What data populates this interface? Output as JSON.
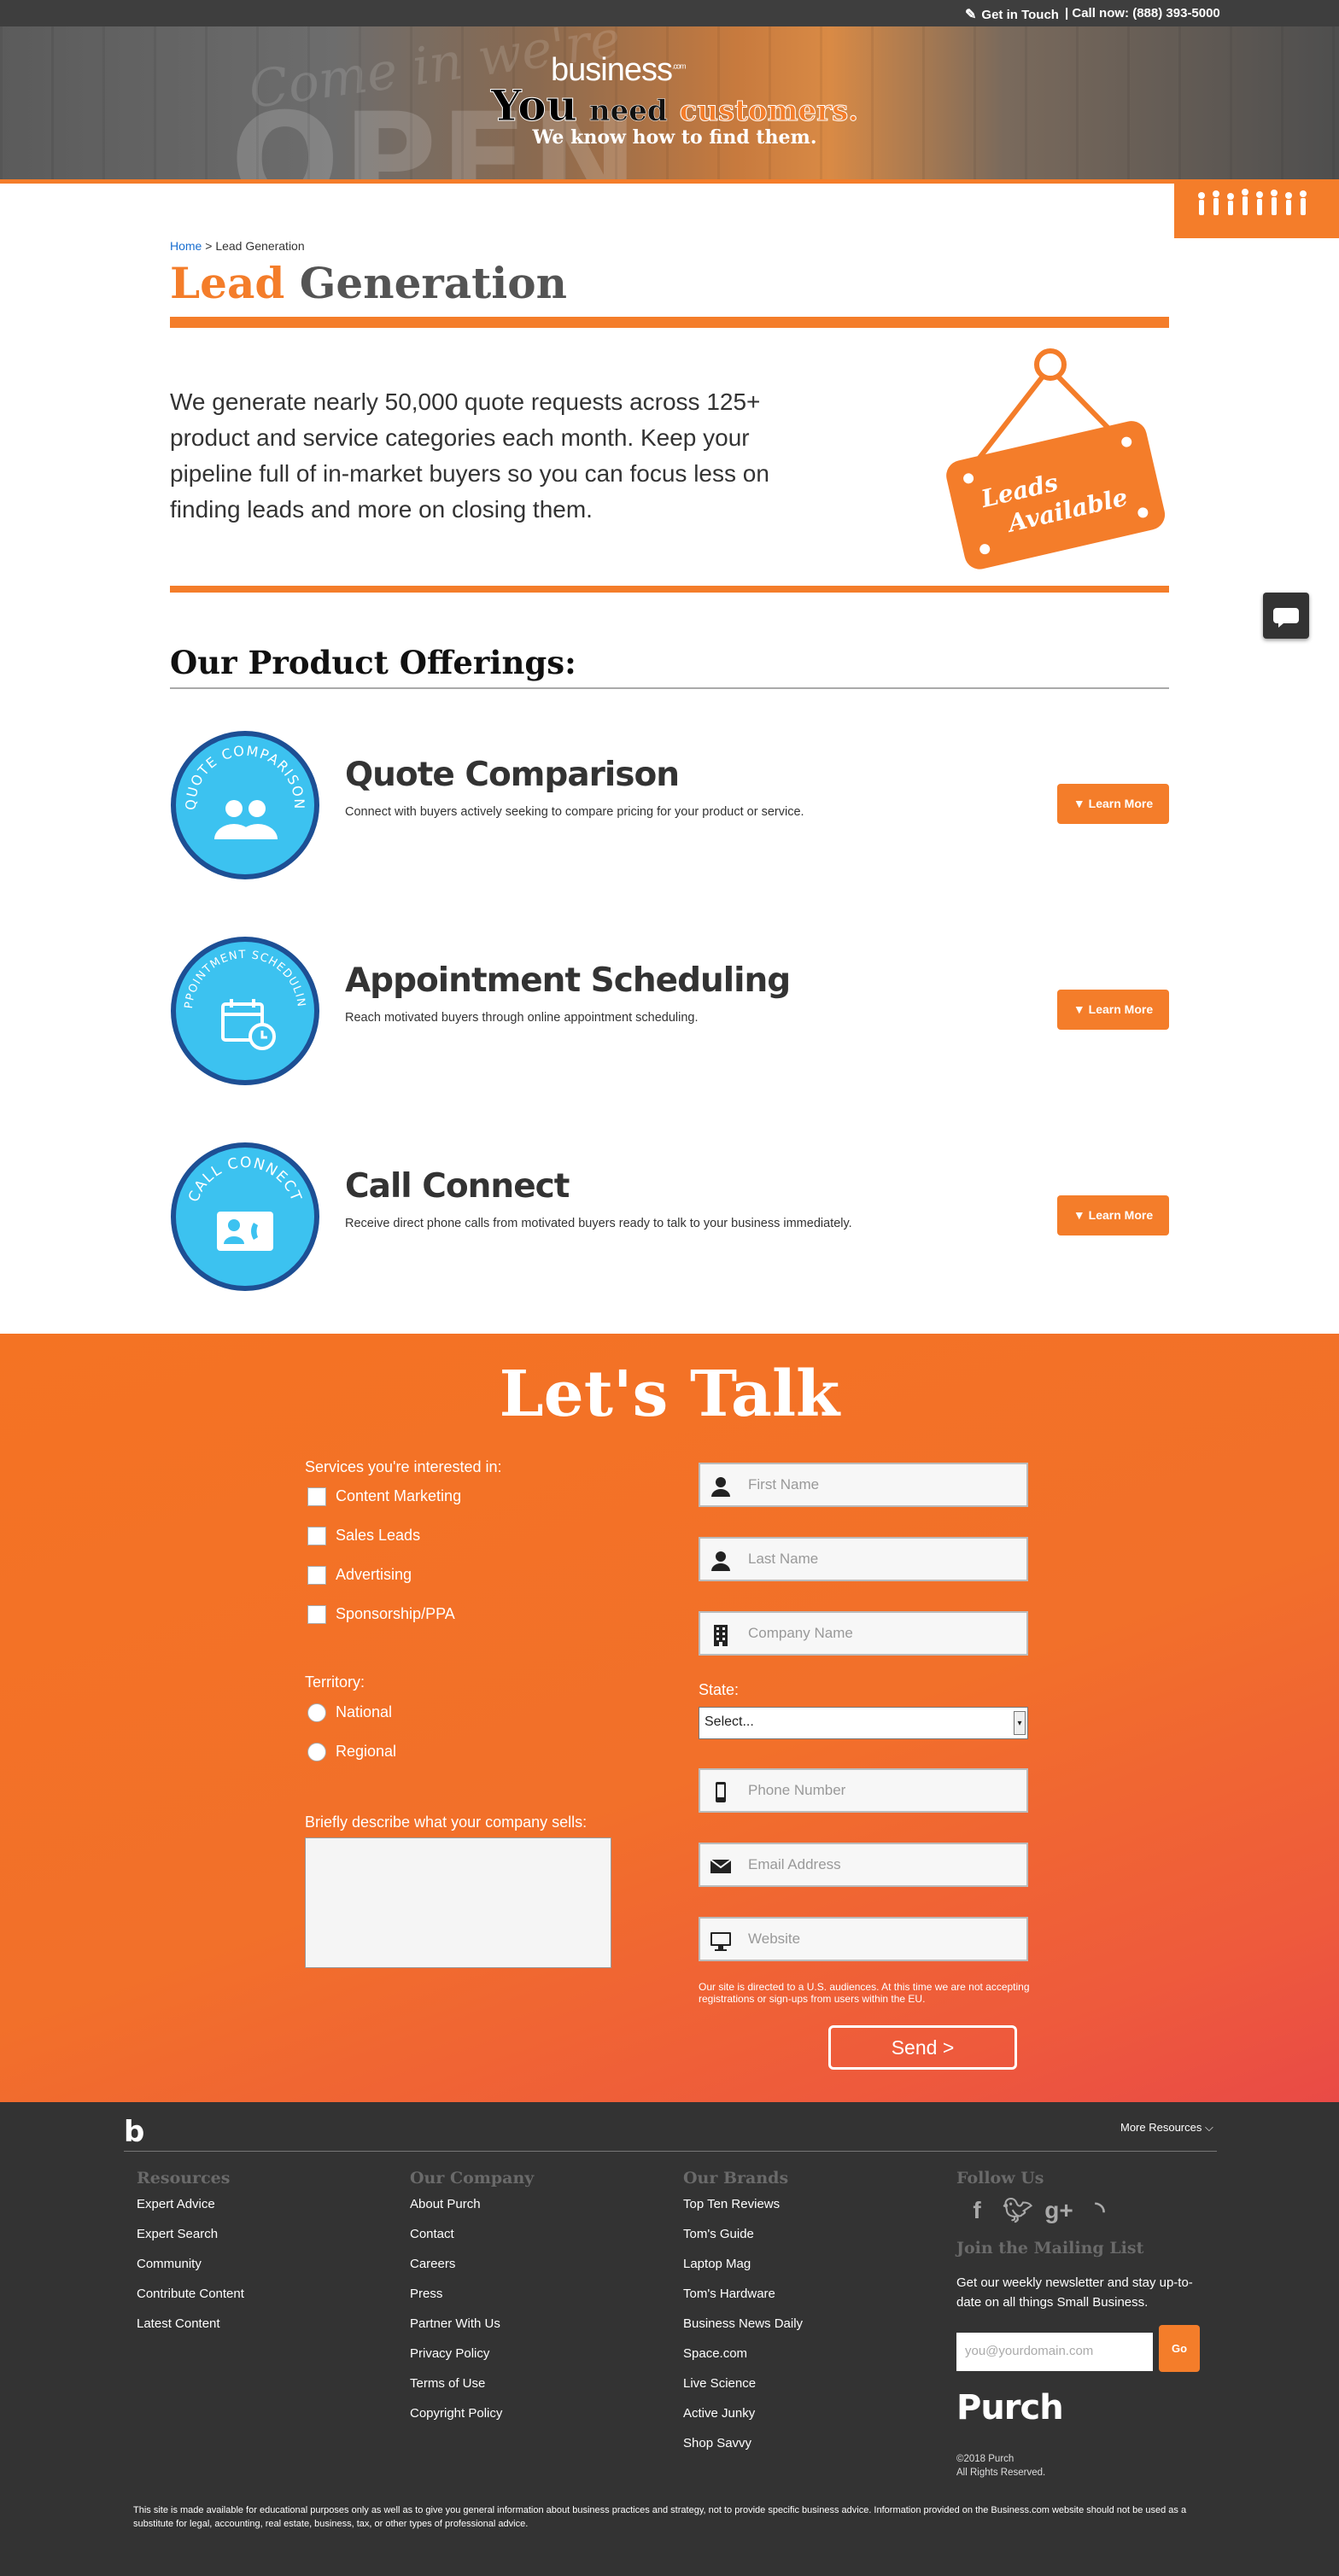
{
  "topbar": {
    "get_in_touch": "Get in Touch",
    "call_now": "| Call now: (888) 393-5000"
  },
  "hero": {
    "brand": "business",
    "brand_sup": ".com",
    "you": "You",
    "need": "need",
    "customers": "customers.",
    "subline": "We know how to find them."
  },
  "breadcrumb": {
    "home": "Home",
    "sep": " > ",
    "current": "Lead Generation"
  },
  "page_title": {
    "accent": "Lead",
    "rest": " Generation"
  },
  "intro": "We generate nearly 50,000 quote requests across 125+ product and service categories each month. Keep your pipeline full of in-market buyers so you can focus less on finding leads and more on closing them.",
  "sign": {
    "line1": "Leads",
    "line2": "Available"
  },
  "offerings": {
    "heading": "Our Product Offerings:",
    "items": [
      {
        "badge": "QUOTE COMPARISON",
        "title": "Quote Comparison",
        "desc": "Connect with buyers actively seeking to compare pricing for your product or service.",
        "button": "▼ Learn More"
      },
      {
        "badge": "APPOINTMENT SCHEDULING",
        "title": "Appointment Scheduling",
        "desc": "Reach motivated buyers through online appointment scheduling.",
        "button": "▼ Learn More"
      },
      {
        "badge": "CALL CONNECT",
        "title": "Call Connect",
        "desc": "Receive direct phone calls from motivated buyers ready to talk to your business immediately.",
        "button": "▼ Learn More"
      }
    ]
  },
  "talk": {
    "heading": "Let's Talk",
    "services_label": "Services you're interested in:",
    "services": [
      "Content Marketing",
      "Sales Leads",
      "Advertising",
      "Sponsorship/PPA"
    ],
    "territory_label": "Territory:",
    "territories": [
      "National",
      "Regional"
    ],
    "describe_label": "Briefly describe what your company sells:",
    "fields": {
      "first_name": "First Name",
      "last_name": "Last Name",
      "company": "Company Name",
      "phone": "Phone Number",
      "email": "Email Address",
      "website": "Website"
    },
    "state_label": "State:",
    "state_value": "Select...",
    "disclaimer": "Our site is directed to a U.S. audiences. At this time we are not accepting registrations or sign-ups from users within the EU.",
    "send": "Send >"
  },
  "footer": {
    "logo": "b",
    "more_resources": "More Resources ⌵",
    "resources": {
      "heading": "Resources",
      "links": [
        "Expert Advice",
        "Expert Search",
        "Community",
        "Contribute Content",
        "Latest Content"
      ]
    },
    "company": {
      "heading": "Our Company",
      "links": [
        "About Purch",
        "Contact",
        "Careers",
        "Press",
        "Partner With Us",
        "Privacy Policy",
        "Terms of Use",
        "Copyright Policy"
      ]
    },
    "brands": {
      "heading": "Our Brands",
      "links": [
        "Top Ten Reviews",
        "Tom's Guide",
        "Laptop Mag",
        "Tom's Hardware",
        "Business News Daily",
        "Space.com",
        "Live Science",
        "Active Junky",
        "Shop Savvy"
      ]
    },
    "follow_heading": "Follow Us",
    "social": [
      "f",
      "t",
      "g+",
      "rss"
    ],
    "mailing_heading": "Join the Mailing List",
    "mailing_text": "Get our weekly newsletter and stay up-to-date on all things Small Business.",
    "email_placeholder": "you@yourdomain.com",
    "go": "Go",
    "purch_logo": "Purch",
    "copyright_1": "©2018 Purch",
    "copyright_2": "All Rights Reserved.",
    "legal": "This site is made available for educational purposes only as well as to give you general information about business practices and strategy, not to provide specific business advice. Information provided on the Business.com website should not be used as a substitute for legal, accounting, real estate, business, tax, or other types of professional advice."
  },
  "colors": {
    "accent": "#f47d2a",
    "badge_blue": "#3cc2f0",
    "badge_ring": "#1d4f94",
    "dark": "#333333"
  }
}
